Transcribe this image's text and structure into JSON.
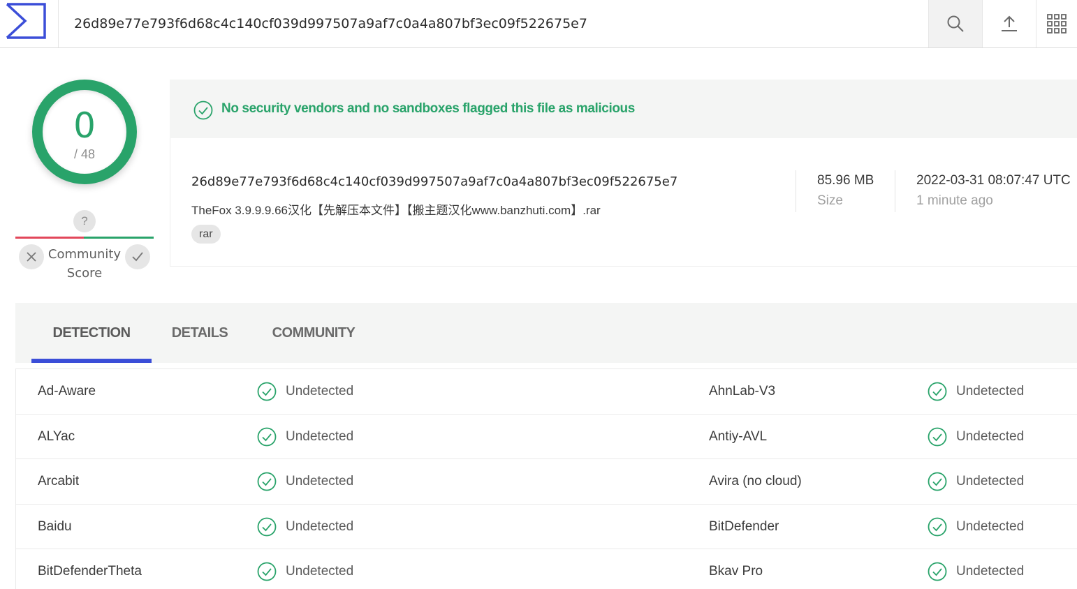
{
  "header": {
    "search_value": "26d89e77e793f6d68c4c140cf039d997507a9af7c0a4a807bf3ec09f522675e7",
    "logo_icon": "virustotal-logo-icon",
    "buttons": [
      "search-icon",
      "upload-icon",
      "apps-grid-icon"
    ]
  },
  "score": {
    "detections": "0",
    "total": "/ 48",
    "ring_color": "#29a36a"
  },
  "community": {
    "question": "?",
    "label_line1": "Community",
    "label_line2": "Score"
  },
  "banner": {
    "text": "No security vendors and no sandboxes flagged this file as malicious",
    "color": "#29a36a"
  },
  "file": {
    "hash": "26d89e77e793f6d68c4c140cf039d997507a9af7c0a4a807bf3ec09f522675e7",
    "name": "TheFox 3.9.9.9.66汉化【先解压本文件】【搬主题汉化www.banzhuti.com】.rar",
    "tag": "rar",
    "size_value": "85.96 MB",
    "size_label": "Size",
    "date_value": "2022-03-31 08:07:47 UTC",
    "date_label": "1 minute ago"
  },
  "tabs": [
    {
      "label": "DETECTION",
      "active": true
    },
    {
      "label": "DETAILS",
      "active": false
    },
    {
      "label": "COMMUNITY",
      "active": false
    }
  ],
  "detections": [
    {
      "left": {
        "vendor": "Ad-Aware",
        "result": "Undetected"
      },
      "right": {
        "vendor": "AhnLab-V3",
        "result": "Undetected"
      }
    },
    {
      "left": {
        "vendor": "ALYac",
        "result": "Undetected"
      },
      "right": {
        "vendor": "Antiy-AVL",
        "result": "Undetected"
      }
    },
    {
      "left": {
        "vendor": "Arcabit",
        "result": "Undetected"
      },
      "right": {
        "vendor": "Avira (no cloud)",
        "result": "Undetected"
      }
    },
    {
      "left": {
        "vendor": "Baidu",
        "result": "Undetected"
      },
      "right": {
        "vendor": "BitDefender",
        "result": "Undetected"
      }
    },
    {
      "left": {
        "vendor": "BitDefenderTheta",
        "result": "Undetected"
      },
      "right": {
        "vendor": "Bkav Pro",
        "result": "Undetected"
      }
    }
  ],
  "colors": {
    "accent_blue": "#3b4ed8",
    "clean_green": "#29a36a",
    "negative_red": "#e2475a"
  }
}
